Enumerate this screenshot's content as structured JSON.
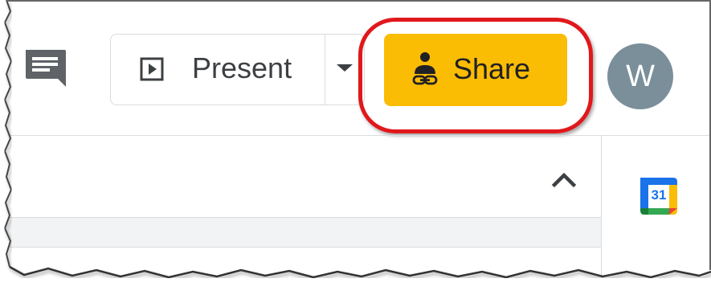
{
  "toolbar": {
    "comments_icon": "comment-icon",
    "present": {
      "label": "Present",
      "icon": "present-play-icon",
      "dropdown_icon": "caret-down-icon"
    },
    "share": {
      "label": "Share",
      "icon": "share-person-link-icon",
      "background": "#fbbc04"
    },
    "avatar": {
      "initial": "W",
      "background": "#7a8f9a"
    }
  },
  "annotation": {
    "highlight_color": "#e0181b"
  },
  "panel": {
    "collapse_icon": "chevron-up-icon"
  },
  "side_panel": {
    "calendar": {
      "icon": "google-calendar-icon",
      "day": "31"
    }
  }
}
